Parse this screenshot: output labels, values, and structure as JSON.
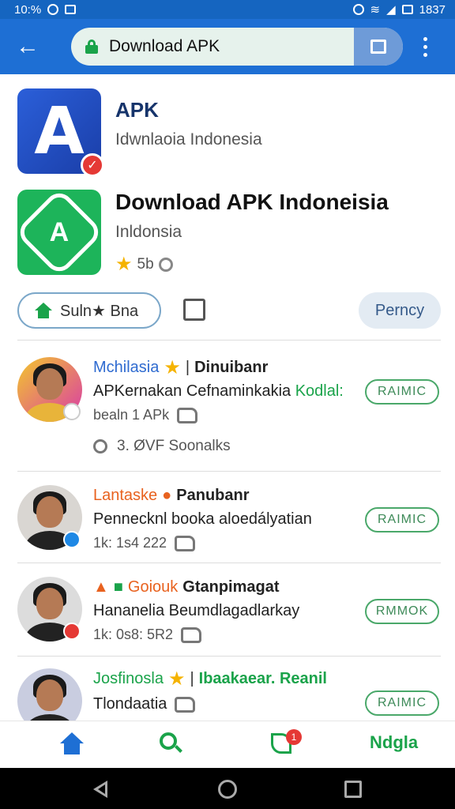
{
  "status_bar": {
    "time": "10:%",
    "right_text": "1837"
  },
  "browser": {
    "url_text": "Download APK"
  },
  "app1": {
    "name": "APK",
    "subtitle": "Idwnlaoia Indonesia"
  },
  "app2": {
    "name": "Download APK Indoneisia",
    "subtitle": "Inldonsia",
    "rating": "5b"
  },
  "actions": {
    "pill_label": "Suln★ Bna",
    "policy_label": "Perncy"
  },
  "reviews": [
    {
      "name": "Mchilasia",
      "badge": "Dinuibanr",
      "text": "APKernakan Cefnaminkakia",
      "text_green": "Kodlal:",
      "meta": "bealn 1 APk",
      "comments": "3. ØVF Soonalks",
      "rank": "RAIMIC",
      "name_color": "#2f6bd0",
      "badge_color": "#1565c0"
    },
    {
      "name": "Lantaske",
      "badge": "Panubanr",
      "text": "Pennecknl booka aloedályatian",
      "text_green": "",
      "meta": "1k: 1s4 222",
      "comments": "",
      "rank": "RAIMIC",
      "name_color": "#e8621f",
      "badge_color": "#1e88e5"
    },
    {
      "name": "Goiouk",
      "badge": "Gtanpimagat",
      "text": "Hananelia Beumdlagadlarkay",
      "text_green": "",
      "meta": "1k: 0s8: 5R2",
      "comments": "",
      "rank": "RMMOK",
      "name_color": "#e8621f",
      "badge_color": "#e53935"
    },
    {
      "name": "Josfinosla",
      "badge": "Ibaakaear. Reanil",
      "text": "Tlondaatia",
      "text_green": "",
      "meta": "",
      "comments": "",
      "rank": "RAIMIC",
      "name_color": "#1aa34a",
      "badge_color": "#e53935"
    }
  ],
  "bottom_nav": {
    "badge_count": "1",
    "text_label": "Ndgla"
  }
}
